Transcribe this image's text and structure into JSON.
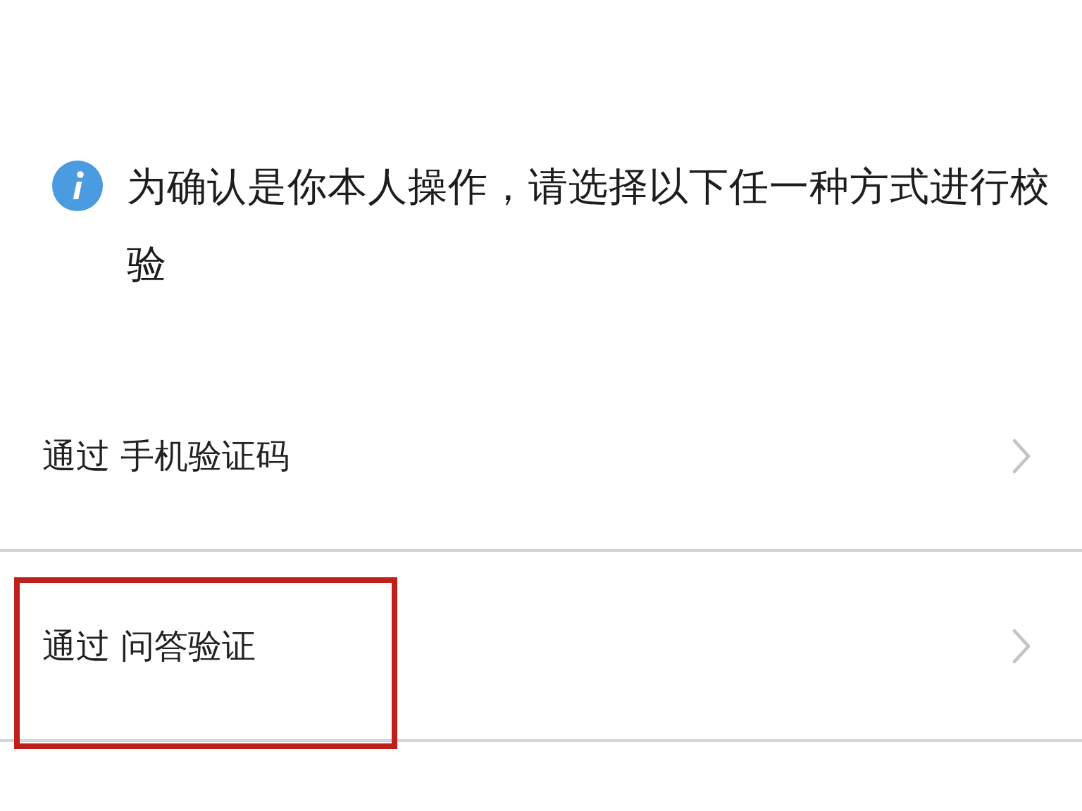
{
  "notice": {
    "text": "为确认是你本人操作，请选择以下任一种方式进行校验"
  },
  "options": [
    {
      "label": "通过 手机验证码",
      "highlighted": false
    },
    {
      "label": "通过 问答验证",
      "highlighted": true
    }
  ]
}
